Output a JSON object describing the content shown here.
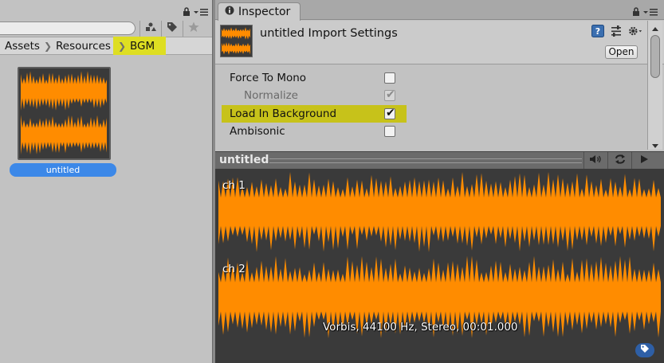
{
  "colors": {
    "waveform": "#ff8c00",
    "highlight": "#dede22",
    "selection": "#3c88e8"
  },
  "project": {
    "breadcrumb": [
      "Assets",
      "Resources",
      "BGM"
    ],
    "asset": {
      "name": "untitled"
    }
  },
  "inspector": {
    "tab_label": "Inspector",
    "title": "untitled Import Settings",
    "open_label": "Open",
    "properties": [
      {
        "label": "Force To Mono",
        "checked": false,
        "disabled": false
      },
      {
        "label": "Normalize",
        "checked": true,
        "disabled": true
      },
      {
        "label": "Load In Background",
        "checked": true,
        "disabled": false
      },
      {
        "label": "Ambisonic",
        "checked": false,
        "disabled": false
      }
    ]
  },
  "preview": {
    "title": "untitled",
    "channels": [
      "ch 1",
      "ch 2"
    ],
    "info": "Vorbis, 44100 Hz, Stereo, 00:01.000"
  }
}
